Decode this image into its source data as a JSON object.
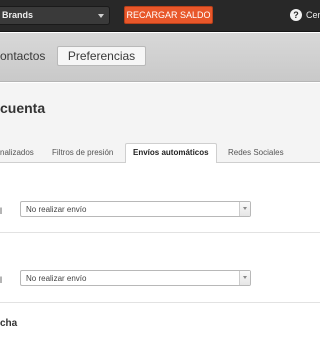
{
  "topbar": {
    "brand_select_value": "Brands",
    "recharge_label": "RECARGAR SALDO",
    "help_label": "Cen"
  },
  "subnav": {
    "contacts_label": "ontactos",
    "preferences_label": "Preferencias"
  },
  "main": {
    "title": "cuenta",
    "tabs": [
      {
        "label": "nalizados"
      },
      {
        "label": "Filtros de presión"
      },
      {
        "label": "Envíos automáticos"
      },
      {
        "label": "Redes Sociales"
      }
    ],
    "active_tab": "Envíos automáticos",
    "rows": [
      {
        "label": "l",
        "select_value": "No realizar envío"
      },
      {
        "label": "l",
        "select_value": "No realizar envío"
      }
    ],
    "section_title": "cha"
  },
  "colors": {
    "topbar_bg": "#282828",
    "accent": "#e8572a",
    "subnav_bg": "#d0d0d0",
    "content_bg": "#f4f4f4"
  }
}
